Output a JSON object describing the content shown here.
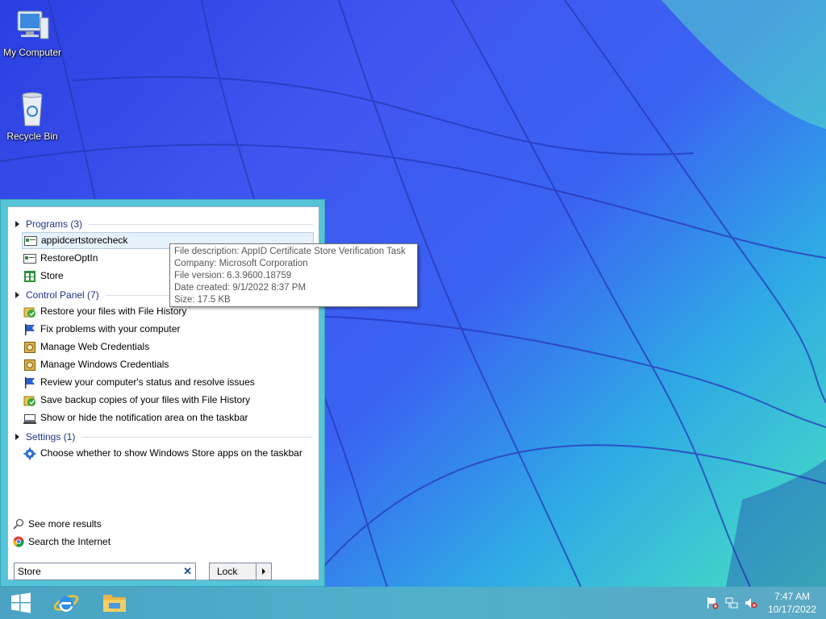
{
  "desktop": {
    "icons": [
      {
        "label": "My Computer",
        "icon": "computer-icon"
      },
      {
        "label": "Recycle Bin",
        "icon": "recycle-bin-icon"
      }
    ]
  },
  "start_menu": {
    "groups": [
      {
        "header": "Programs (3)",
        "items": [
          "appidcertstorecheck",
          "RestoreOptIn",
          "Store"
        ]
      },
      {
        "header": "Control Panel (7)",
        "items": [
          "Restore your files with File History",
          "Fix problems with your computer",
          "Manage Web Credentials",
          "Manage Windows Credentials",
          "Review your computer's status and resolve issues",
          "Save backup copies of your files with File History",
          "Show or hide the notification area on the taskbar"
        ]
      },
      {
        "header": "Settings (1)",
        "items": [
          "Choose whether to show Windows Store apps on the taskbar"
        ]
      }
    ],
    "see_more": "See more results",
    "search_internet": "Search the Internet",
    "search": {
      "value": "Store",
      "clear": "✕"
    },
    "power_button": "Lock"
  },
  "tooltip": {
    "lines": [
      "File description: AppID Certificate Store Verification Task",
      "Company: Microsoft Corporation",
      "File version: 6.3.9600.18759",
      "Date created: 9/1/2022 8:37 PM",
      "Size: 17.5 KB"
    ]
  },
  "taskbar": {
    "pinned": [
      "start-button",
      "internet-explorer-icon",
      "file-explorer-icon"
    ],
    "clock": {
      "time": "7:47 AM",
      "date": "10/17/2022"
    }
  }
}
